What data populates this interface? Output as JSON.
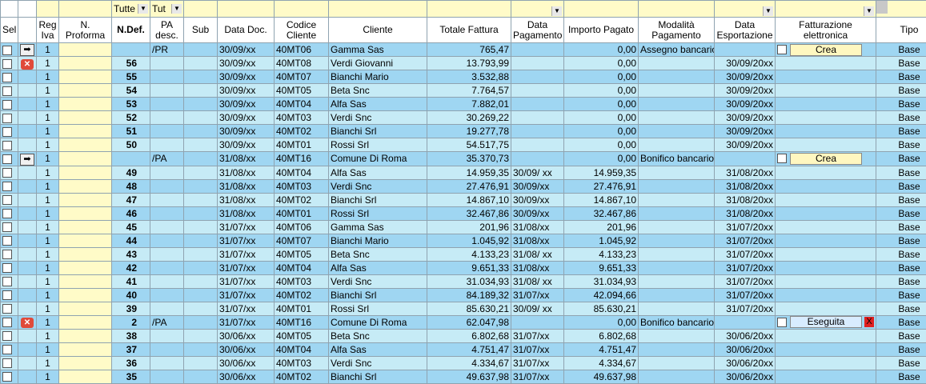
{
  "filters": {
    "ndef": "Tutte",
    "pa": "Tut"
  },
  "headers": {
    "sel": "Sel",
    "reg": "Reg Iva",
    "proforma": "N. Proforma",
    "ndef": "N.Def.",
    "pa": "PA desc.",
    "sub": "Sub",
    "data_doc": "Data Doc.",
    "codice": "Codice Cliente",
    "cliente": "Cliente",
    "totale": "Totale Fattura",
    "data_pag": "Data Pagamento",
    "importo": "Importo Pagato",
    "modalita": "Modalità Pagamento",
    "data_exp": "Data Esportazione",
    "fe": "Fatturazione elettronica",
    "tipo": "Tipo"
  },
  "rows": [
    {
      "icon": "arrow",
      "reg": "1",
      "ndef": "",
      "pa": "/PR",
      "data_doc": "30/09/xx",
      "codice": "40MT06",
      "cliente": "Gamma Sas",
      "totale": "765,47",
      "data_pag": "",
      "importo": "0,00",
      "modalita": "Assegno bancario",
      "data_exp": "",
      "fe": "Crea",
      "tipo": "Base"
    },
    {
      "icon": "error",
      "reg": "1",
      "ndef": "56",
      "pa": "",
      "data_doc": "30/09/xx",
      "codice": "40MT08",
      "cliente": "Verdi Giovanni",
      "totale": "13.793,99",
      "data_pag": "",
      "importo": "0,00",
      "modalita": "",
      "data_exp": "30/09/20xx",
      "fe": "",
      "tipo": "Base"
    },
    {
      "icon": "",
      "reg": "1",
      "ndef": "55",
      "pa": "",
      "data_doc": "30/09/xx",
      "codice": "40MT07",
      "cliente": "Bianchi Mario",
      "totale": "3.532,88",
      "data_pag": "",
      "importo": "0,00",
      "modalita": "",
      "data_exp": "30/09/20xx",
      "fe": "",
      "tipo": "Base"
    },
    {
      "icon": "",
      "reg": "1",
      "ndef": "54",
      "pa": "",
      "data_doc": "30/09/xx",
      "codice": "40MT05",
      "cliente": "Beta Snc",
      "totale": "7.764,57",
      "data_pag": "",
      "importo": "0,00",
      "modalita": "",
      "data_exp": "30/09/20xx",
      "fe": "",
      "tipo": "Base"
    },
    {
      "icon": "",
      "reg": "1",
      "ndef": "53",
      "pa": "",
      "data_doc": "30/09/xx",
      "codice": "40MT04",
      "cliente": "Alfa Sas",
      "totale": "7.882,01",
      "data_pag": "",
      "importo": "0,00",
      "modalita": "",
      "data_exp": "30/09/20xx",
      "fe": "",
      "tipo": "Base"
    },
    {
      "icon": "",
      "reg": "1",
      "ndef": "52",
      "pa": "",
      "data_doc": "30/09/xx",
      "codice": "40MT03",
      "cliente": "Verdi Snc",
      "totale": "30.269,22",
      "data_pag": "",
      "importo": "0,00",
      "modalita": "",
      "data_exp": "30/09/20xx",
      "fe": "",
      "tipo": "Base"
    },
    {
      "icon": "",
      "reg": "1",
      "ndef": "51",
      "pa": "",
      "data_doc": "30/09/xx",
      "codice": "40MT02",
      "cliente": "Bianchi Srl",
      "totale": "19.277,78",
      "data_pag": "",
      "importo": "0,00",
      "modalita": "",
      "data_exp": "30/09/20xx",
      "fe": "",
      "tipo": "Base"
    },
    {
      "icon": "",
      "reg": "1",
      "ndef": "50",
      "pa": "",
      "data_doc": "30/09/xx",
      "codice": "40MT01",
      "cliente": "Rossi Srl",
      "totale": "54.517,75",
      "data_pag": "",
      "importo": "0,00",
      "modalita": "",
      "data_exp": "30/09/20xx",
      "fe": "",
      "tipo": "Base"
    },
    {
      "icon": "arrow",
      "reg": "1",
      "ndef": "",
      "pa": "/PA",
      "data_doc": "31/08/xx",
      "codice": "40MT16",
      "cliente": "Comune Di Roma",
      "totale": "35.370,73",
      "data_pag": "",
      "importo": "0,00",
      "modalita": "Bonifico bancario",
      "data_exp": "",
      "fe": "Crea",
      "tipo": "Base"
    },
    {
      "icon": "",
      "reg": "1",
      "ndef": "49",
      "pa": "",
      "data_doc": "31/08/xx",
      "codice": "40MT04",
      "cliente": "Alfa Sas",
      "totale": "14.959,35",
      "data_pag": "30/09/ xx",
      "importo": "14.959,35",
      "modalita": "",
      "data_exp": "31/08/20xx",
      "fe": "",
      "tipo": "Base"
    },
    {
      "icon": "",
      "reg": "1",
      "ndef": "48",
      "pa": "",
      "data_doc": "31/08/xx",
      "codice": "40MT03",
      "cliente": "Verdi Snc",
      "totale": "27.476,91",
      "data_pag": "30/09/xx",
      "importo": "27.476,91",
      "modalita": "",
      "data_exp": "31/08/20xx",
      "fe": "",
      "tipo": "Base"
    },
    {
      "icon": "",
      "reg": "1",
      "ndef": "47",
      "pa": "",
      "data_doc": "31/08/xx",
      "codice": "40MT02",
      "cliente": "Bianchi Srl",
      "totale": "14.867,10",
      "data_pag": "30/09/xx",
      "importo": "14.867,10",
      "modalita": "",
      "data_exp": "31/08/20xx",
      "fe": "",
      "tipo": "Base"
    },
    {
      "icon": "",
      "reg": "1",
      "ndef": "46",
      "pa": "",
      "data_doc": "31/08/xx",
      "codice": "40MT01",
      "cliente": "Rossi Srl",
      "totale": "32.467,86",
      "data_pag": "30/09/xx",
      "importo": "32.467,86",
      "modalita": "",
      "data_exp": "31/08/20xx",
      "fe": "",
      "tipo": "Base"
    },
    {
      "icon": "",
      "reg": "1",
      "ndef": "45",
      "pa": "",
      "data_doc": "31/07/xx",
      "codice": "40MT06",
      "cliente": "Gamma Sas",
      "totale": "201,96",
      "data_pag": "31/08/xx",
      "importo": "201,96",
      "modalita": "",
      "data_exp": "31/07/20xx",
      "fe": "",
      "tipo": "Base"
    },
    {
      "icon": "",
      "reg": "1",
      "ndef": "44",
      "pa": "",
      "data_doc": "31/07/xx",
      "codice": "40MT07",
      "cliente": "Bianchi Mario",
      "totale": "1.045,92",
      "data_pag": "31/08/xx",
      "importo": "1.045,92",
      "modalita": "",
      "data_exp": "31/07/20xx",
      "fe": "",
      "tipo": "Base"
    },
    {
      "icon": "",
      "reg": "1",
      "ndef": "43",
      "pa": "",
      "data_doc": "31/07/xx",
      "codice": "40MT05",
      "cliente": "Beta Snc",
      "totale": "4.133,23",
      "data_pag": "31/08/ xx",
      "importo": "4.133,23",
      "modalita": "",
      "data_exp": "31/07/20xx",
      "fe": "",
      "tipo": "Base"
    },
    {
      "icon": "",
      "reg": "1",
      "ndef": "42",
      "pa": "",
      "data_doc": "31/07/xx",
      "codice": "40MT04",
      "cliente": "Alfa Sas",
      "totale": "9.651,33",
      "data_pag": "31/08/xx",
      "importo": "9.651,33",
      "modalita": "",
      "data_exp": "31/07/20xx",
      "fe": "",
      "tipo": "Base"
    },
    {
      "icon": "",
      "reg": "1",
      "ndef": "41",
      "pa": "",
      "data_doc": "31/07/xx",
      "codice": "40MT03",
      "cliente": "Verdi Snc",
      "totale": "31.034,93",
      "data_pag": "31/08/ xx",
      "importo": "31.034,93",
      "modalita": "",
      "data_exp": "31/07/20xx",
      "fe": "",
      "tipo": "Base"
    },
    {
      "icon": "",
      "reg": "1",
      "ndef": "40",
      "pa": "",
      "data_doc": "31/07/xx",
      "codice": "40MT02",
      "cliente": "Bianchi Srl",
      "totale": "84.189,32",
      "data_pag": "31/07/xx",
      "importo": "42.094,66",
      "modalita": "",
      "data_exp": "31/07/20xx",
      "fe": "",
      "tipo": "Base"
    },
    {
      "icon": "",
      "reg": "1",
      "ndef": "39",
      "pa": "",
      "data_doc": "31/07/xx",
      "codice": "40MT01",
      "cliente": "Rossi Srl",
      "totale": "85.630,21",
      "data_pag": "30/09/ xx",
      "importo": "85.630,21",
      "modalita": "",
      "data_exp": "31/07/20xx",
      "fe": "",
      "tipo": "Base"
    },
    {
      "icon": "error",
      "reg": "1",
      "ndef": "2",
      "pa": "/PA",
      "data_doc": "31/07/xx",
      "codice": "40MT16",
      "cliente": "Comune Di Roma",
      "totale": "62.047,98",
      "data_pag": "",
      "importo": "0,00",
      "modalita": "Bonifico bancario",
      "data_exp": "",
      "fe": "Eseguita",
      "tipo": "Base"
    },
    {
      "icon": "",
      "reg": "1",
      "ndef": "38",
      "pa": "",
      "data_doc": "30/06/xx",
      "codice": "40MT05",
      "cliente": "Beta Snc",
      "totale": "6.802,68",
      "data_pag": "31/07/xx",
      "importo": "6.802,68",
      "modalita": "",
      "data_exp": "30/06/20xx",
      "fe": "",
      "tipo": "Base"
    },
    {
      "icon": "",
      "reg": "1",
      "ndef": "37",
      "pa": "",
      "data_doc": "30/06/xx",
      "codice": "40MT04",
      "cliente": "Alfa Sas",
      "totale": "4.751,47",
      "data_pag": "31/07/xx",
      "importo": "4.751,47",
      "modalita": "",
      "data_exp": "30/06/20xx",
      "fe": "",
      "tipo": "Base"
    },
    {
      "icon": "",
      "reg": "1",
      "ndef": "36",
      "pa": "",
      "data_doc": "30/06/xx",
      "codice": "40MT03",
      "cliente": "Verdi Snc",
      "totale": "4.334,67",
      "data_pag": "31/07/xx",
      "importo": "4.334,67",
      "modalita": "",
      "data_exp": "30/06/20xx",
      "fe": "",
      "tipo": "Base"
    },
    {
      "icon": "",
      "reg": "1",
      "ndef": "35",
      "pa": "",
      "data_doc": "30/06/xx",
      "codice": "40MT02",
      "cliente": "Bianchi Srl",
      "totale": "49.637,98",
      "data_pag": "31/07/xx",
      "importo": "49.637,98",
      "modalita": "",
      "data_exp": "30/06/20xx",
      "fe": "",
      "tipo": "Base"
    }
  ],
  "fe_delete_label": "X"
}
